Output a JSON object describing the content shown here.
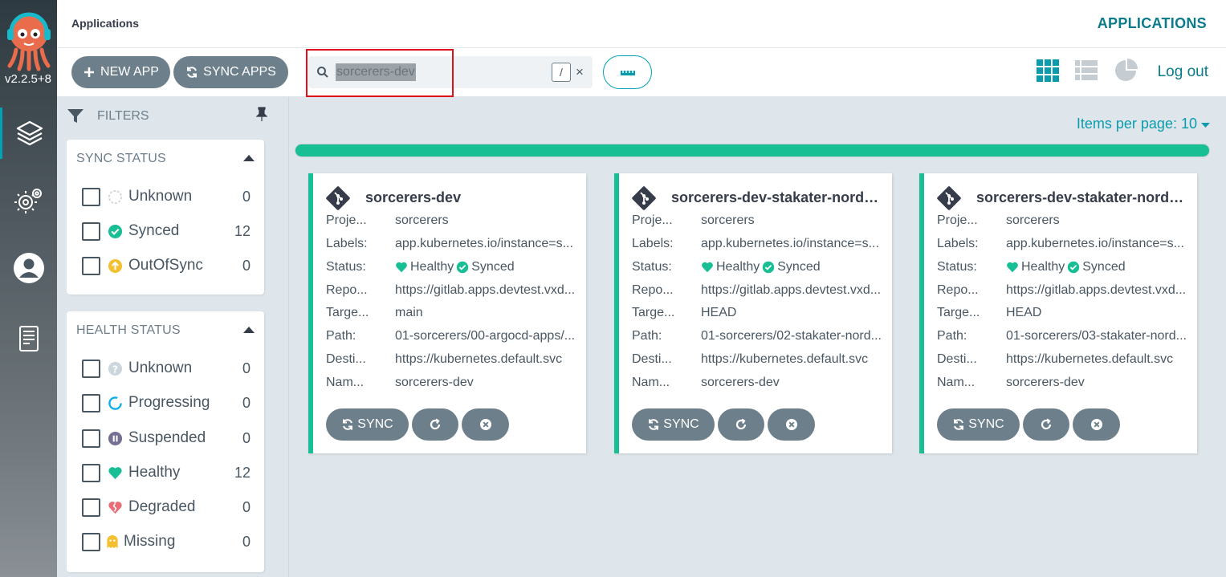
{
  "app": {
    "version": "v2.2.5+8",
    "breadcrumb": "Applications",
    "title": "APPLICATIONS",
    "logout": "Log out"
  },
  "toolbar": {
    "new_app": "NEW APP",
    "sync_apps": "SYNC APPS",
    "search_value": "sorcerers-dev",
    "search_shortcut": "/",
    "clear": "×"
  },
  "filters": {
    "title": "FILTERS",
    "sync_status": {
      "title": "SYNC STATUS",
      "items": [
        {
          "label": "Unknown",
          "count": "0",
          "icon": "unknown-circle-icon"
        },
        {
          "label": "Synced",
          "count": "12",
          "icon": "check-circle-icon"
        },
        {
          "label": "OutOfSync",
          "count": "0",
          "icon": "arrow-up-circle-icon"
        }
      ]
    },
    "health_status": {
      "title": "HEALTH STATUS",
      "items": [
        {
          "label": "Unknown",
          "count": "0",
          "icon": "question-circle-icon"
        },
        {
          "label": "Progressing",
          "count": "0",
          "icon": "spinner-icon"
        },
        {
          "label": "Suspended",
          "count": "0",
          "icon": "pause-circle-icon"
        },
        {
          "label": "Healthy",
          "count": "12",
          "icon": "heart-icon"
        },
        {
          "label": "Degraded",
          "count": "0",
          "icon": "broken-heart-icon"
        },
        {
          "label": "Missing",
          "count": "0",
          "icon": "ghost-icon"
        }
      ]
    }
  },
  "main": {
    "items_per_page": "Items per page: 10",
    "progress": 1.0
  },
  "cards": [
    {
      "name": "sorcerers-dev",
      "labels": {
        "project": "Proje...",
        "labels": "Labels:",
        "status": "Status:",
        "repo": "Repo...",
        "target": "Targe...",
        "path": "Path:",
        "destination": "Desti...",
        "namespace": "Nam..."
      },
      "project": "sorcerers",
      "label_value": "app.kubernetes.io/instance=s...",
      "health": "Healthy",
      "sync": "Synced",
      "repo": "https://gitlab.apps.devtest.vxd...",
      "target": "main",
      "path": "01-sorcerers/00-argocd-apps/...",
      "destination": "https://kubernetes.default.svc",
      "namespace": "sorcerers-dev",
      "sync_button": "SYNC"
    },
    {
      "name": "sorcerers-dev-stakater-nordm...",
      "labels": {
        "project": "Proje...",
        "labels": "Labels:",
        "status": "Status:",
        "repo": "Repo...",
        "target": "Targe...",
        "path": "Path:",
        "destination": "Desti...",
        "namespace": "Nam..."
      },
      "project": "sorcerers",
      "label_value": "app.kubernetes.io/instance=s...",
      "health": "Healthy",
      "sync": "Synced",
      "repo": "https://gitlab.apps.devtest.vxd...",
      "target": "HEAD",
      "path": "01-sorcerers/02-stakater-nord...",
      "destination": "https://kubernetes.default.svc",
      "namespace": "sorcerers-dev",
      "sync_button": "SYNC"
    },
    {
      "name": "sorcerers-dev-stakater-nordm...",
      "labels": {
        "project": "Proje...",
        "labels": "Labels:",
        "status": "Status:",
        "repo": "Repo...",
        "target": "Targe...",
        "path": "Path:",
        "destination": "Desti...",
        "namespace": "Nam..."
      },
      "project": "sorcerers",
      "label_value": "app.kubernetes.io/instance=s...",
      "health": "Healthy",
      "sync": "Synced",
      "repo": "https://gitlab.apps.devtest.vxd...",
      "target": "HEAD",
      "path": "01-sorcerers/03-stakater-nord...",
      "destination": "https://kubernetes.default.svc",
      "namespace": "sorcerers-dev",
      "sync_button": "SYNC"
    }
  ],
  "colors": {
    "accent": "#0a7b8a",
    "healthy": "#18be94",
    "button": "#6d7f8b",
    "highlight_box": "#e0101a"
  }
}
